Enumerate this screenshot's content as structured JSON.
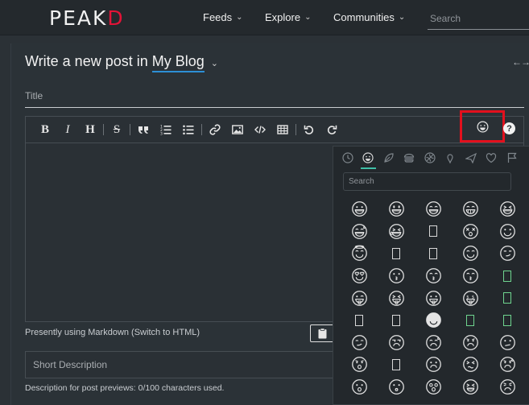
{
  "header": {
    "logo_main": "PEAK",
    "logo_accent": "D",
    "nav": [
      {
        "label": "Feeds"
      },
      {
        "label": "Explore"
      },
      {
        "label": "Communities"
      }
    ],
    "search_placeholder": "Search"
  },
  "editor": {
    "heading_prefix": "Write a new post in",
    "blog_name": "My Blog",
    "title_placeholder": "Title",
    "markdown_note": "Presently using Markdown (Switch to HTML)",
    "short_desc_placeholder": "Short Description",
    "desc_note": "Description for post previews: 0/100 characters used.",
    "help_label": "?",
    "toolbar": {
      "bold": "B",
      "italic": "I",
      "heading": "H",
      "strike": "S"
    }
  },
  "emoji_picker": {
    "search_placeholder": "Search",
    "categories": [
      "recent-icon",
      "smileys-icon",
      "nature-icon",
      "food-icon",
      "activity-icon",
      "places-icon",
      "travel-icon",
      "symbols-icon",
      "flags-icon"
    ],
    "active_category": "smileys-icon",
    "emoji_names": [
      "grinning",
      "grinning-big-eyes",
      "grinning-squinting",
      "beaming",
      "laughing",
      "sweat-smile",
      "rolling-laughing",
      "unrendered",
      "dizzy-smile",
      "slight-smile",
      "halo",
      "unrendered",
      "unrendered",
      "relieved",
      "smirk-clock",
      "heart-eyes",
      "kissing",
      "kissing-closed",
      "kissing-smile",
      "unrendered-green",
      "tongue-wink",
      "tongue-squint",
      "tongue",
      "money-mouth",
      "unrendered-green",
      "unrendered",
      "unrendered",
      "sunglasses",
      "unrendered-green",
      "unrendered-green",
      "smirk",
      "unamused",
      "frown-sweat",
      "worried",
      "confused",
      "concerned",
      "unrendered",
      "frowning",
      "persevering",
      "anxious",
      "open-mouth",
      "hushed",
      "astonished",
      "tired",
      "weary"
    ]
  },
  "colors": {
    "brand_red": "#e31337",
    "highlight_red": "#e3101d",
    "link_blue": "#2d8fd5",
    "tab_teal": "#3fbfa7"
  }
}
